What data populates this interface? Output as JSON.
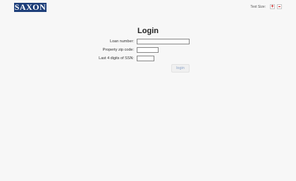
{
  "header": {
    "logo_text": "SAXON",
    "text_size_label": "Text Size:",
    "increase_icon": "plus-icon",
    "decrease_icon": "minus-icon"
  },
  "form": {
    "title": "Login",
    "fields": [
      {
        "label": "Loan number:",
        "value": ""
      },
      {
        "label": "Property zip code:",
        "value": ""
      },
      {
        "label": "Last 4 digits of SSN:",
        "value": ""
      }
    ],
    "submit_label": "login"
  },
  "colors": {
    "logo_bg": "#1e3f7a",
    "accent": "#cc2222",
    "button_text": "#8aa2c8"
  }
}
